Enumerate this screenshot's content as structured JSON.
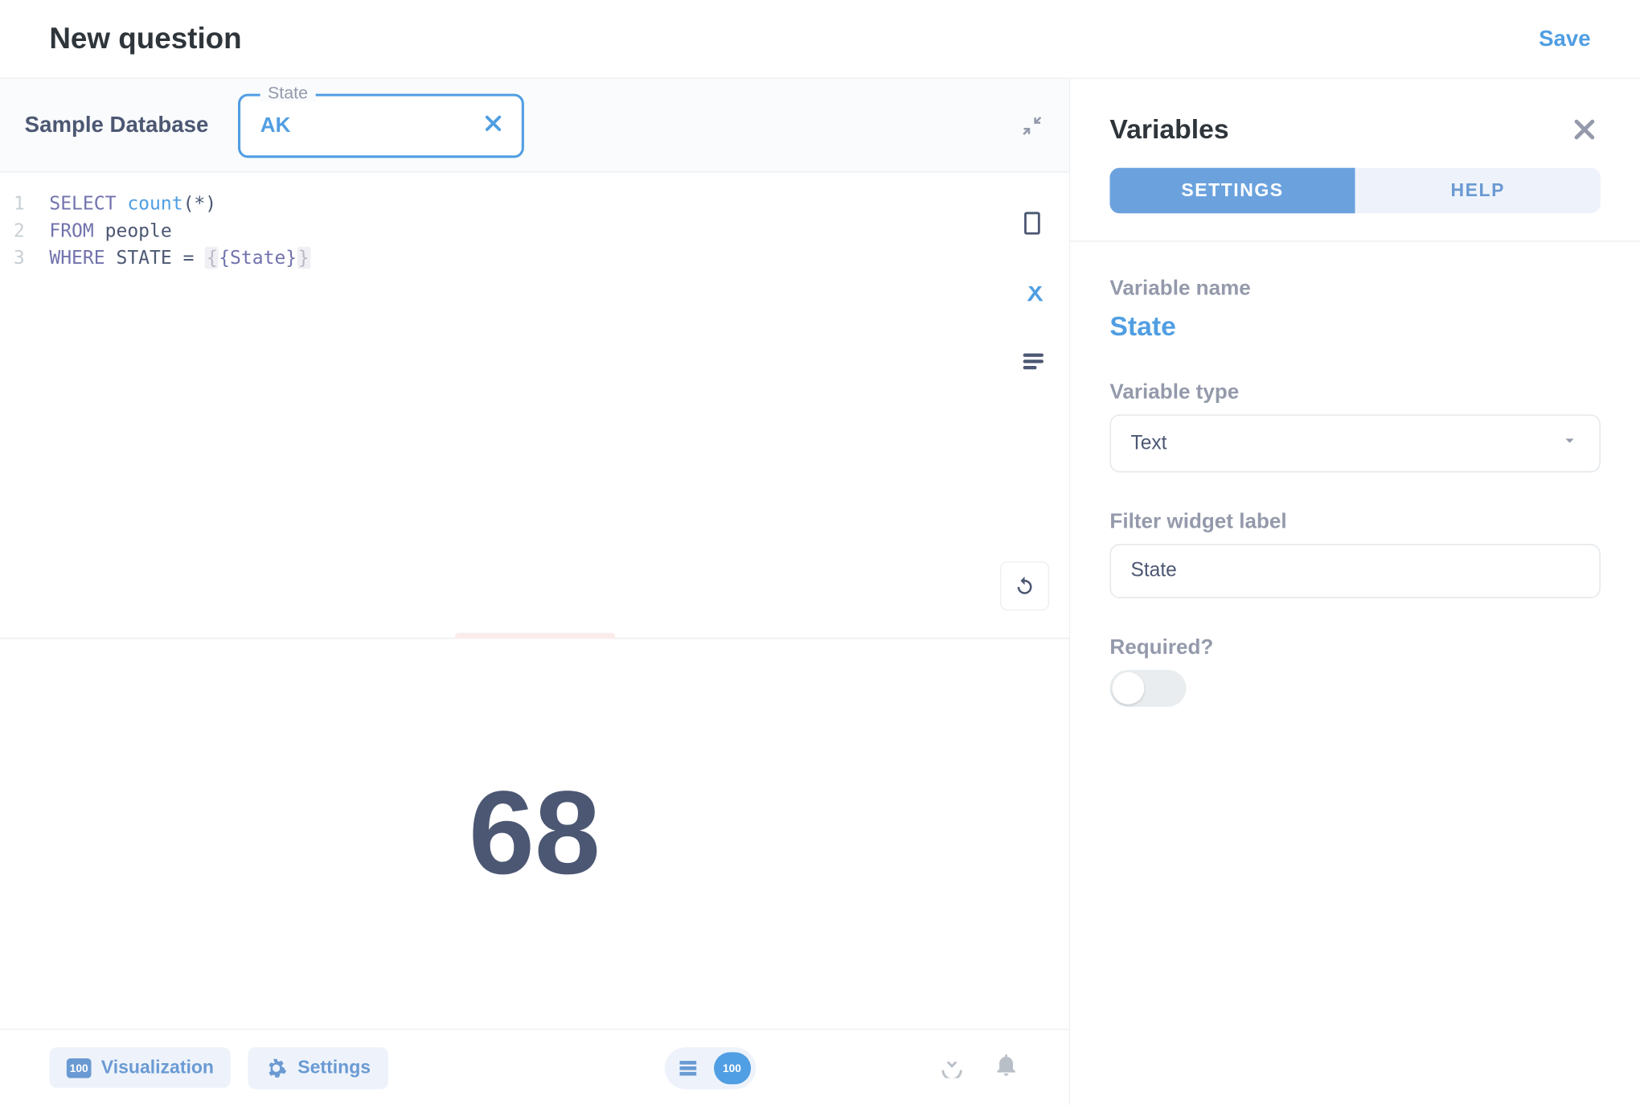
{
  "header": {
    "title": "New question",
    "save_label": "Save"
  },
  "query_bar": {
    "database": "Sample Database",
    "filter": {
      "label": "State",
      "value": "AK"
    }
  },
  "editor": {
    "lines": [
      "1",
      "2",
      "3"
    ]
  },
  "result": {
    "value": "68"
  },
  "footer": {
    "visualization_label": "Visualization",
    "settings_label": "Settings"
  },
  "panel": {
    "title": "Variables",
    "tabs": {
      "settings": "SETTINGS",
      "help": "HELP"
    },
    "variable_name_label": "Variable name",
    "variable_name": "State",
    "variable_type_label": "Variable type",
    "variable_type": "Text",
    "filter_widget_label_lbl": "Filter widget label",
    "filter_widget_label": "State",
    "required_label": "Required?"
  }
}
